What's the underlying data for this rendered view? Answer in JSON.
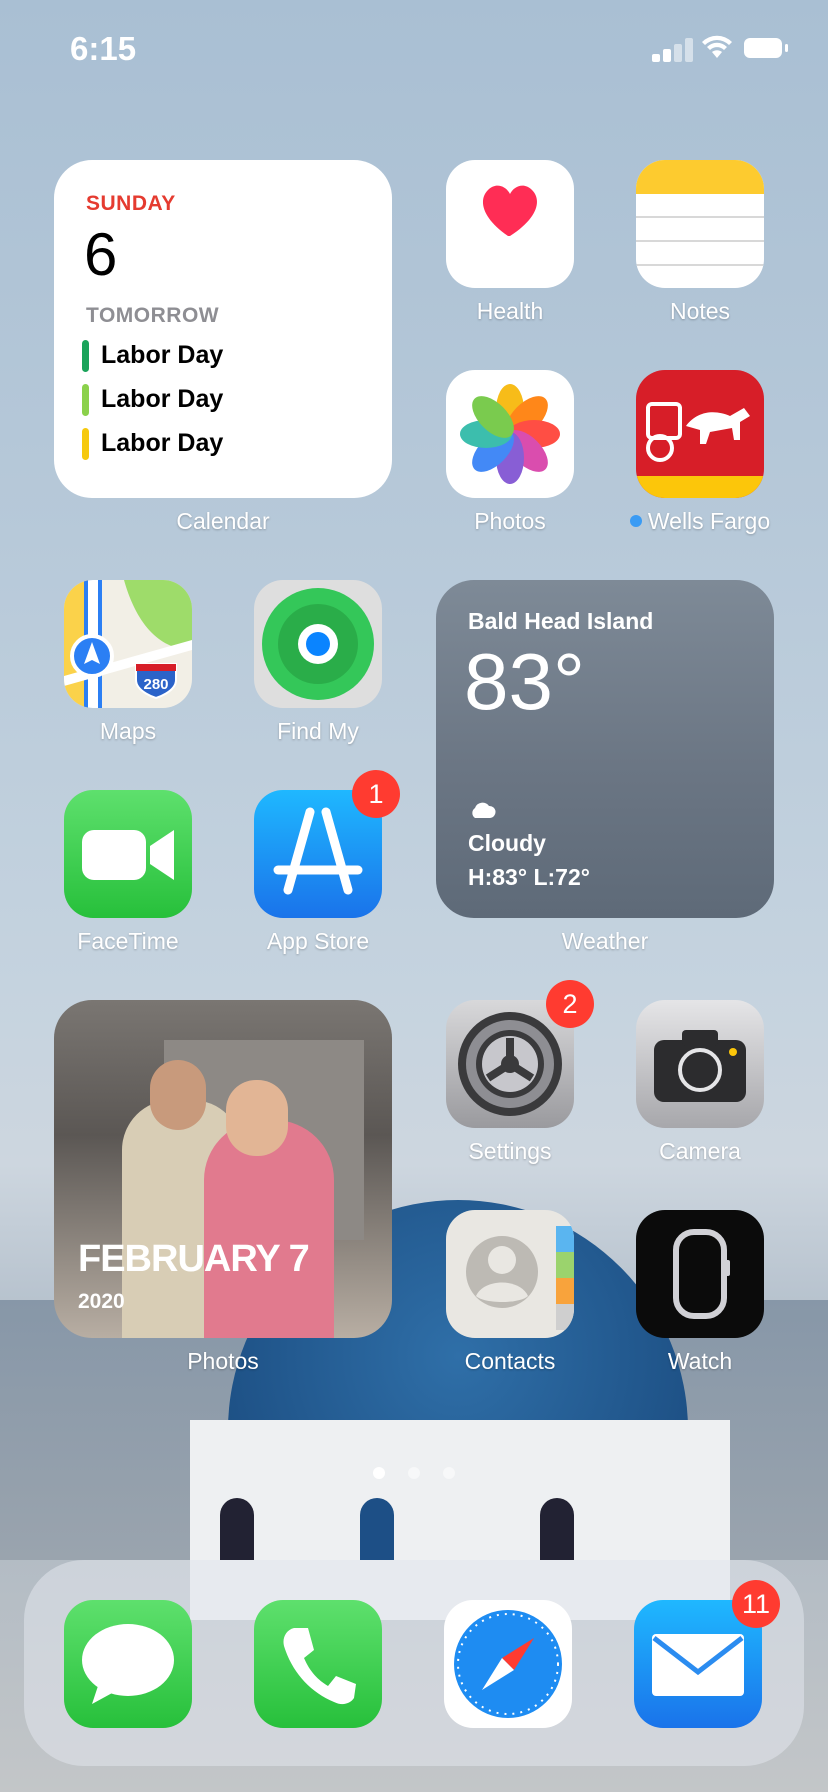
{
  "status": {
    "time": "6:15"
  },
  "calendar_widget": {
    "day_name": "SUNDAY",
    "date": "6",
    "section": "TOMORROW",
    "events": [
      {
        "title": "Labor Day",
        "color": "#1aa35a"
      },
      {
        "title": "Labor Day",
        "color": "#8bd14b"
      },
      {
        "title": "Labor Day",
        "color": "#f6c90e"
      }
    ],
    "label": "Calendar"
  },
  "apps": {
    "health": "Health",
    "notes": "Notes",
    "photos": "Photos",
    "wells_fargo": "Wells Fargo",
    "maps": "Maps",
    "find_my": "Find My",
    "facetime": "FaceTime",
    "app_store": "App Store",
    "app_store_badge": "1",
    "settings": "Settings",
    "settings_badge": "2",
    "camera": "Camera",
    "contacts": "Contacts",
    "watch": "Watch",
    "maps_shield": "280"
  },
  "weather_widget": {
    "location": "Bald Head Island",
    "temperature": "83°",
    "condition": "Cloudy",
    "high_low": "H:83° L:72°",
    "label": "Weather"
  },
  "photos_widget": {
    "date": "FEBRUARY 7",
    "year": "2020",
    "label": "Photos"
  },
  "dock": {
    "mail_badge": "11"
  },
  "colors": {
    "badge": "#ff3b30",
    "calendar_red": "#e53b30",
    "green": "#34c759",
    "blue": "#0a84ff"
  }
}
